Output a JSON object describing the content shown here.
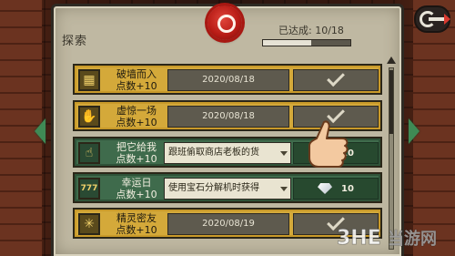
{
  "panel": {
    "title": "探索",
    "progress_label": "已达成: 10/18",
    "progress_value": 0.5556
  },
  "rows": [
    {
      "name_line1": "破墙而入",
      "name_line2": "点数+10",
      "status": "2020/08/18",
      "icon": "wall-icon",
      "style": "gold",
      "reward_type": "check"
    },
    {
      "name_line1": "虚惊一场",
      "name_line2": "点数+10",
      "status": "2020/08/18",
      "icon": "scared-hand-icon",
      "style": "gold",
      "reward_type": "check"
    },
    {
      "name_line1": "把它给我",
      "name_line2": "点数+10",
      "hint": "跟班偷取商店老板的货",
      "icon": "grab-hand-icon",
      "style": "green",
      "reward_type": "gem",
      "reward": "10"
    },
    {
      "name_line1": "幸运日",
      "name_line2": "点数+10",
      "hint": "使用宝石分解机时获得",
      "icon": "triple-seven-icon",
      "style": "green",
      "reward_type": "gem",
      "reward": "10"
    },
    {
      "name_line1": "精灵密友",
      "name_line2": "点数+10",
      "status": "2020/08/19",
      "icon": "sparkle-icon",
      "style": "gold",
      "reward_type": "check"
    }
  ],
  "icons": {
    "seal": "wax-seal-magnifier-icon",
    "exit": "exit-arrow-icon",
    "nav_left": "arrow-left-icon",
    "nav_right": "arrow-right-icon"
  },
  "watermark": "3DM 当游网",
  "colors": {
    "completed_row": "#d4a93a",
    "incomplete_row": "#3f6b4c",
    "parchment": "#bfb8a2"
  }
}
